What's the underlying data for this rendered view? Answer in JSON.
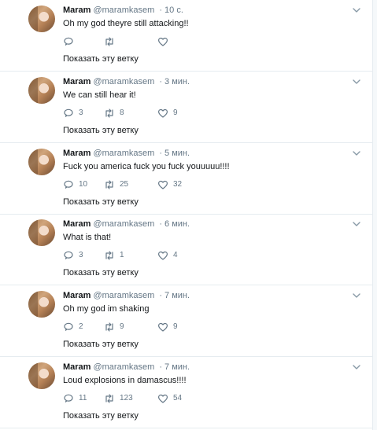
{
  "tweets": [
    {
      "name": "Maram",
      "handle": "@maramkasem",
      "time": "· 10 с.",
      "text": "Oh my god theyre still attacking!!",
      "replies": "",
      "retweets": "",
      "likes": "",
      "thread_link": "Показать эту ветку"
    },
    {
      "name": "Maram",
      "handle": "@maramkasem",
      "time": "· 3 мин.",
      "text": "We can still hear it!",
      "replies": "3",
      "retweets": "8",
      "likes": "9",
      "thread_link": "Показать эту ветку"
    },
    {
      "name": "Maram",
      "handle": "@maramkasem",
      "time": "· 5 мин.",
      "text": "Fuck you america fuck you fuck youuuuu!!!!",
      "replies": "10",
      "retweets": "25",
      "likes": "32",
      "thread_link": "Показать эту ветку"
    },
    {
      "name": "Maram",
      "handle": "@maramkasem",
      "time": "· 6 мин.",
      "text": "What is that!",
      "replies": "3",
      "retweets": "1",
      "likes": "4",
      "thread_link": "Показать эту ветку"
    },
    {
      "name": "Maram",
      "handle": "@maramkasem",
      "time": "· 7 мин.",
      "text": "Oh my god im shaking",
      "replies": "2",
      "retweets": "9",
      "likes": "9",
      "thread_link": "Показать эту ветку"
    },
    {
      "name": "Maram",
      "handle": "@maramkasem",
      "time": "· 7 мин.",
      "text": "Loud explosions in damascus!!!!",
      "replies": "11",
      "retweets": "123",
      "likes": "54",
      "thread_link": "Показать эту ветку"
    }
  ],
  "icons": {
    "reply": "reply-icon",
    "retweet": "retweet-icon",
    "like": "heart-icon",
    "more": "chevron-down-icon"
  },
  "colors": {
    "name": "#14171a",
    "secondary": "#657786",
    "divider": "#e6ecf0"
  }
}
